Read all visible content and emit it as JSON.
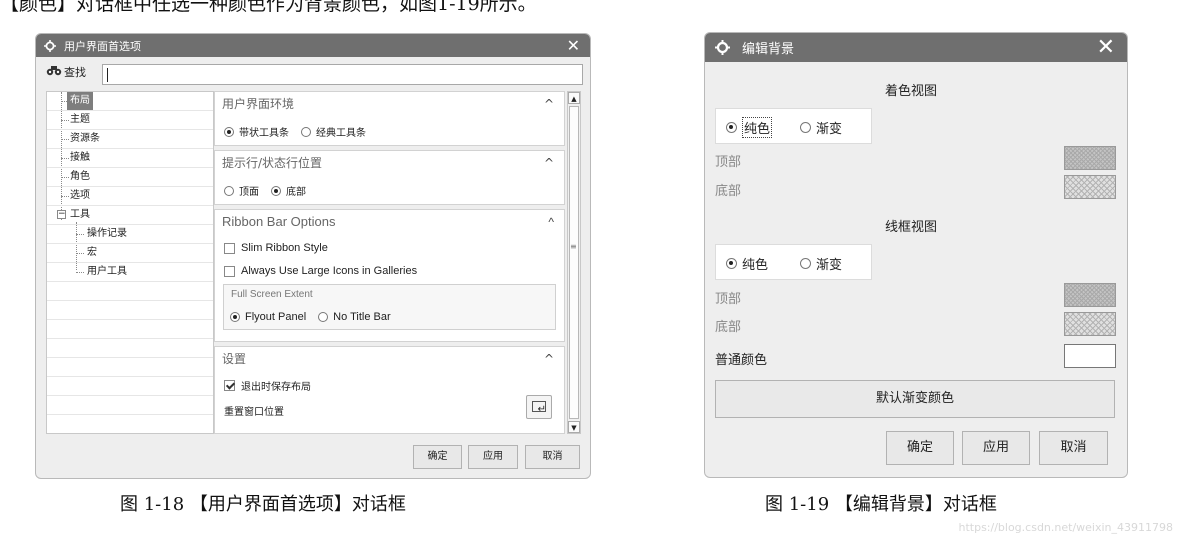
{
  "page": {
    "top_text": "【颜色】对话框中任选一种颜色作为背景颜色，如图1-19所示。",
    "caption_left": "图 1-18  【用户界面首选项】对话框",
    "caption_right": "图 1-19  【编辑背景】对话框",
    "watermark": "https://blog.csdn.net/weixin_43911798"
  },
  "dialog_prefs": {
    "title": "用户界面首选项",
    "icons": {
      "title": "gear-icon",
      "close": "close-icon",
      "find": "binoculars-icon"
    },
    "close_glyph": "✕",
    "find_label": "查找",
    "find_value": "",
    "tree": {
      "items": [
        {
          "label": "布局",
          "selected": true
        },
        {
          "label": "主题"
        },
        {
          "label": "资源条"
        },
        {
          "label": "接触"
        },
        {
          "label": "角色"
        },
        {
          "label": "选项"
        },
        {
          "label": "工具",
          "expander": "−"
        },
        {
          "label": "操作记录"
        },
        {
          "label": "宏"
        },
        {
          "label": "用户工具"
        }
      ]
    },
    "groups": {
      "env": {
        "title": "用户界面环境",
        "options": [
          "带状工具条",
          "经典工具条"
        ],
        "selected": 0
      },
      "prompt": {
        "title": "提示行/状态行位置",
        "options": [
          "顶面",
          "底部"
        ],
        "selected": 1
      },
      "ribbon": {
        "title": "Ribbon Bar Options",
        "checks": [
          {
            "label": "Slim Ribbon Style",
            "checked": false
          },
          {
            "label": "Always Use Large Icons in Galleries",
            "checked": false
          }
        ],
        "full_screen_label": "Full Screen Extent",
        "full_screen_options": [
          "Flyout Panel",
          "No Title Bar"
        ],
        "full_screen_selected": 0
      },
      "settings": {
        "title": "设置",
        "check_label": "退出时保存布局",
        "check_checked": true,
        "reset_label": "重置窗口位置"
      }
    },
    "chevron": "^",
    "buttons": {
      "ok": "确定",
      "apply": "应用",
      "cancel": "取消"
    }
  },
  "dialog_bg": {
    "title": "编辑背景",
    "close_glyph": "✕",
    "shaded_view": {
      "heading": "着色视图",
      "options": [
        "纯色",
        "渐变"
      ],
      "selected": 0,
      "top_label": "顶部",
      "bottom_label": "底部"
    },
    "wireframe_view": {
      "heading": "线框视图",
      "options": [
        "纯色",
        "渐变"
      ],
      "selected": 0,
      "top_label": "顶部",
      "bottom_label": "底部"
    },
    "normal_color_label": "普通颜色",
    "default_gradient_button": "默认渐变颜色",
    "buttons": {
      "ok": "确定",
      "apply": "应用",
      "cancel": "取消"
    },
    "colors": {
      "normal_color": "#ffffff"
    }
  }
}
